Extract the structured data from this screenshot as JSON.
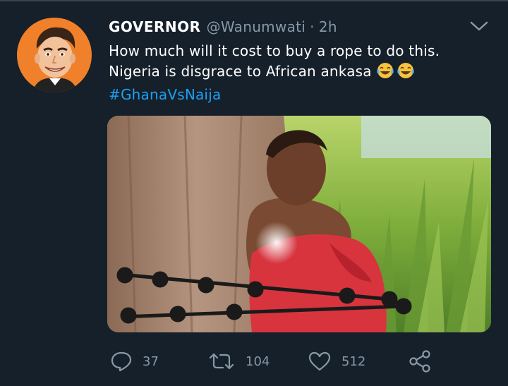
{
  "tweet": {
    "author_name": "GOVERNOR",
    "handle": "@Wanumwati",
    "separator": "·",
    "time": "2h",
    "line1": "How much will it cost to buy a rope to do this.",
    "line2": "Nigeria is disgrace to African ankasa",
    "hashtag": "#GhanaVsNaija",
    "emoji_icons": [
      "tears-of-joy-icon",
      "tears-of-joy-icon"
    ],
    "media_description_icon": "photo"
  },
  "actions": {
    "replies": "37",
    "retweets": "104",
    "likes": "512"
  },
  "icons": {
    "reply": "reply-icon",
    "retweet": "retweet-icon",
    "like": "heart-icon",
    "share": "share-icon",
    "menu": "chevron-down-icon"
  },
  "colors": {
    "background": "#15202b",
    "secondary_text": "#8899a6",
    "link": "#1da1f2",
    "avatar_bg": "#f0812a"
  }
}
